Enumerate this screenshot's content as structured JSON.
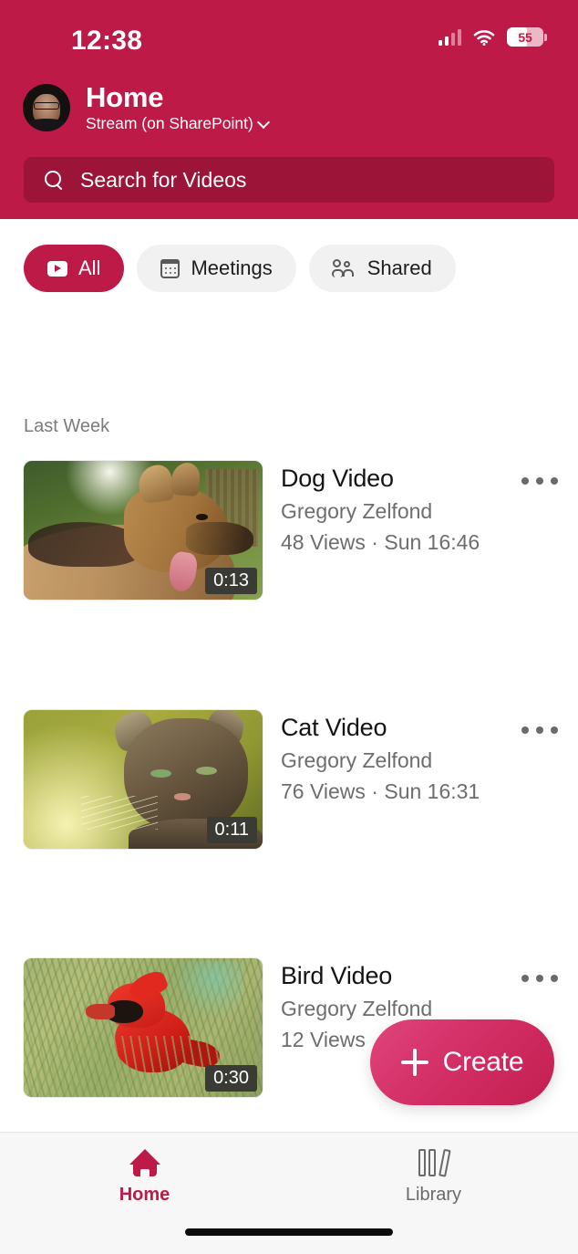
{
  "status_bar": {
    "time": "12:38",
    "battery_percent": "55",
    "signal_icon": "cellular-signal-icon",
    "wifi_icon": "wifi-icon",
    "battery_icon": "battery-icon"
  },
  "header": {
    "title": "Home",
    "subtitle": "Stream (on SharePoint)",
    "avatar_name": "user-avatar",
    "chevron_icon": "chevron-down-icon",
    "background_color": "#BE1A47",
    "search": {
      "placeholder": "Search for Videos",
      "value": "",
      "icon": "search-icon",
      "field_color": "#9C1538"
    }
  },
  "filters": [
    {
      "label": "All",
      "icon": "video-play-icon",
      "active": true
    },
    {
      "label": "Meetings",
      "icon": "calendar-icon",
      "active": false
    },
    {
      "label": "Shared",
      "icon": "people-icon",
      "active": false
    }
  ],
  "content": {
    "section_label": "Last Week",
    "videos": [
      {
        "title": "Dog Video",
        "author": "Gregory Zelfond",
        "stats": "48 Views · Sun 16:46",
        "duration": "0:13",
        "thumbnail": "dog-thumbnail"
      },
      {
        "title": "Cat Video",
        "author": "Gregory Zelfond",
        "stats": "76 Views · Sun 16:31",
        "duration": "0:11",
        "thumbnail": "cat-thumbnail"
      },
      {
        "title": "Bird Video",
        "author": "Gregory Zelfond",
        "stats": "12 Views",
        "duration": "0:30",
        "thumbnail": "bird-thumbnail"
      }
    ],
    "overflow_icon": "more-options-icon"
  },
  "create_button": {
    "label": "Create",
    "icon": "plus-icon",
    "color": "#C41E50"
  },
  "bottom_nav": {
    "items": [
      {
        "label": "Home",
        "icon": "home-icon",
        "active": true
      },
      {
        "label": "Library",
        "icon": "library-books-icon",
        "active": false
      }
    ],
    "accent_color": "#BE1A47"
  }
}
